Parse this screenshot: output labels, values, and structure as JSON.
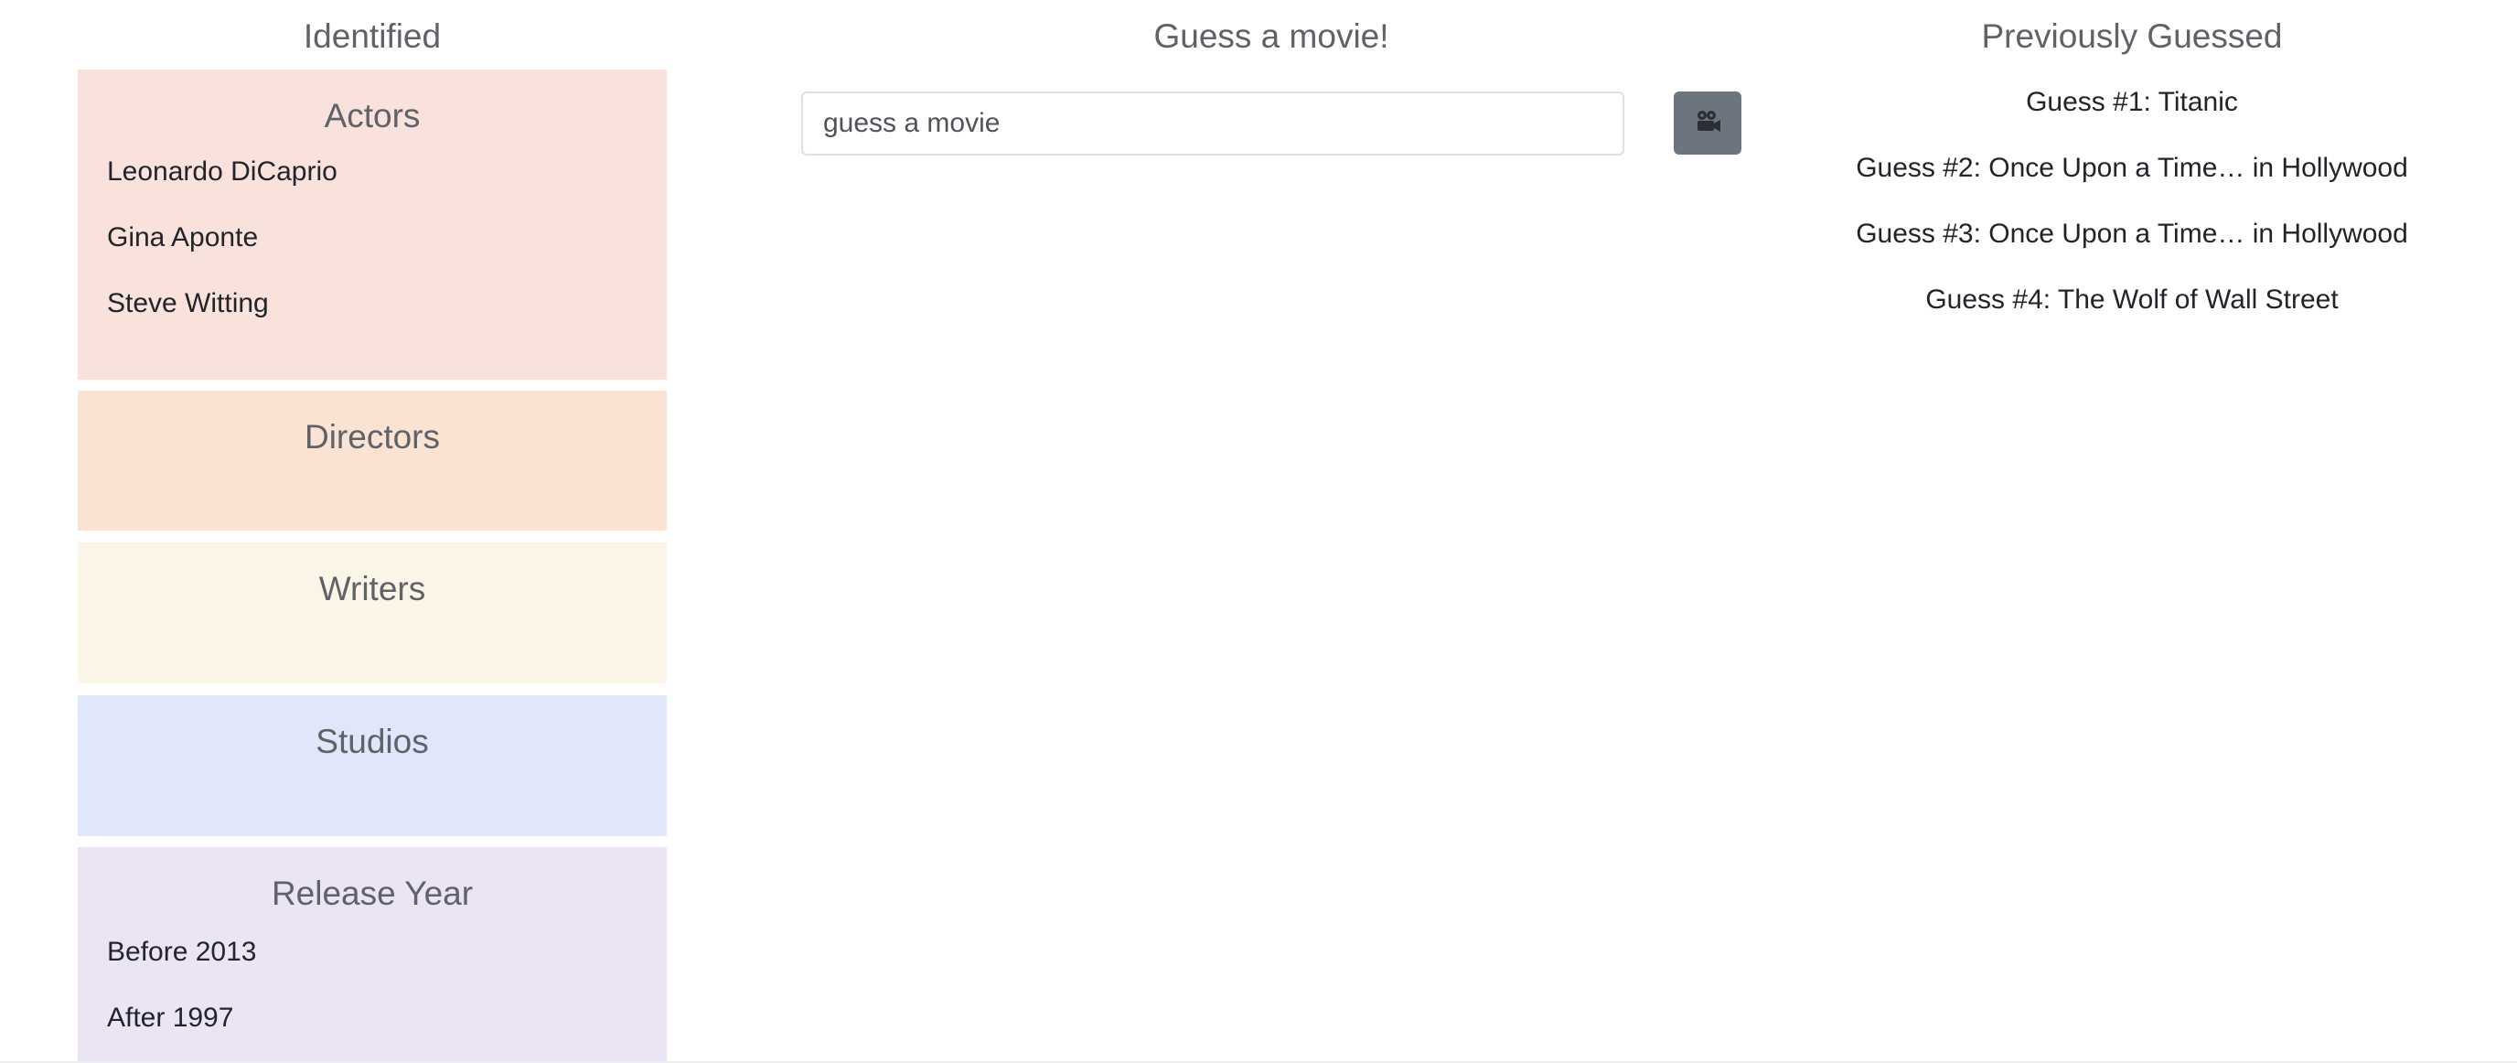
{
  "left": {
    "heading": "Identified",
    "panels": {
      "actors": {
        "title": "Actors",
        "items": [
          "Leonardo DiCaprio",
          "Gina Aponte",
          "Steve Witting"
        ],
        "color": "#f9e1dc"
      },
      "directors": {
        "title": "Directors",
        "items": [],
        "color": "#fae3d2"
      },
      "writers": {
        "title": "Writers",
        "items": [],
        "color": "#fbf5e7"
      },
      "studios": {
        "title": "Studios",
        "items": [],
        "color": "#e1e7fa"
      },
      "release_year": {
        "title": "Release Year",
        "items": [
          "Before 2013",
          "After 1997"
        ],
        "color": "#ebe4f5"
      }
    }
  },
  "middle": {
    "heading": "Guess a movie!",
    "search": {
      "value": "",
      "placeholder": "guess a movie"
    },
    "guess_button": {
      "icon": "movie-camera-icon",
      "color": "#6c757d"
    }
  },
  "right": {
    "heading": "Previously Guessed",
    "guesses": [
      "Guess #1: Titanic",
      "Guess #2: Once Upon a Time… in Hollywood",
      "Guess #3: Once Upon a Time… in Hollywood",
      "Guess #4: The Wolf of Wall Street"
    ]
  }
}
